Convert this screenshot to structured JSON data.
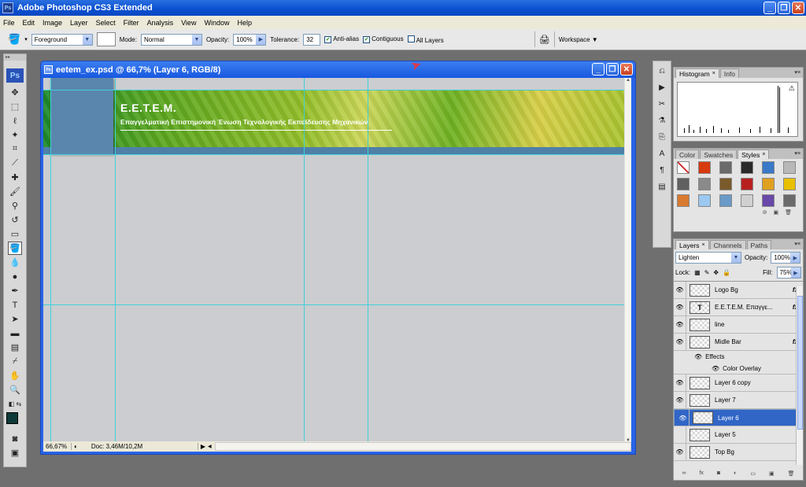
{
  "app": {
    "title": "Adobe Photoshop CS3 Extended",
    "icon": "Ps"
  },
  "menu": [
    "File",
    "Edit",
    "Image",
    "Layer",
    "Select",
    "Filter",
    "Analysis",
    "View",
    "Window",
    "Help"
  ],
  "options": {
    "fill_source": "Foreground",
    "mode_label": "Mode:",
    "mode_value": "Normal",
    "opacity_label": "Opacity:",
    "opacity_value": "100%",
    "tolerance_label": "Tolerance:",
    "tolerance_value": "32",
    "antialias_label": "Anti-alias",
    "antialias_checked": true,
    "contiguous_label": "Contiguous",
    "contiguous_checked": true,
    "all_layers_label": "All Layers",
    "all_layers_checked": false,
    "workspace_label": "Workspace"
  },
  "document": {
    "title": "eetem_ex.psd @ 66,7% (Layer 6, RGB/8)",
    "zoom": "66,67%",
    "doc_size": "Doc: 3,46M/10,2M",
    "banner_logo": "E.E.T.E.M.",
    "banner_subtitle": "Επαγγελματική Επιστημονική Ένωση Τεχνολογικής Εκπαίδευσης Μηχανικών"
  },
  "histogram_panel": {
    "tabs": [
      "Histogram",
      "Info"
    ]
  },
  "styles_panel": {
    "tabs": [
      "Color",
      "Swatches",
      "Styles"
    ],
    "swatch_colors": [
      "#ffffff",
      "#d83a10",
      "#6a6a6a",
      "#2a2a2a",
      "#3a78c8",
      "#b8b8b8",
      "#606060",
      "#8a8a8a",
      "#7a5a2a",
      "#b82020",
      "#e0a020",
      "#e8c000",
      "#d87a30",
      "#9ac8f0",
      "#6a9ac8",
      "#d0d0d0",
      "#6848a8",
      "#6a6a6a"
    ]
  },
  "layers_panel": {
    "tabs": [
      "Layers",
      "Channels",
      "Paths"
    ],
    "blend_mode": "Lighten",
    "opacity_label": "Opacity:",
    "opacity_value": "100%",
    "lock_label": "Lock:",
    "fill_label": "Fill:",
    "fill_value": "75%",
    "layers": [
      {
        "name": "Logo Bg",
        "fx": "fx",
        "visible": true,
        "type": "pixel"
      },
      {
        "name": "E.E.T.E.M. Επαγγε...",
        "fx": "fx",
        "visible": true,
        "type": "text"
      },
      {
        "name": "line",
        "fx": "",
        "visible": true,
        "type": "pixel"
      },
      {
        "name": "Midle Bar",
        "fx": "fx",
        "visible": true,
        "type": "pixel"
      },
      {
        "name": "Layer 6 copy",
        "fx": "",
        "visible": true,
        "type": "pixel"
      },
      {
        "name": "Layer 7",
        "fx": "",
        "visible": true,
        "type": "pixel"
      },
      {
        "name": "Layer 6",
        "fx": "",
        "visible": true,
        "type": "pixel",
        "selected": true
      },
      {
        "name": "Layer 5",
        "fx": "",
        "visible": false,
        "type": "pixel"
      },
      {
        "name": "Top Bg",
        "fx": "",
        "visible": true,
        "type": "pixel"
      }
    ],
    "effects_label": "Effects",
    "effect_item": "Color Overlay"
  }
}
